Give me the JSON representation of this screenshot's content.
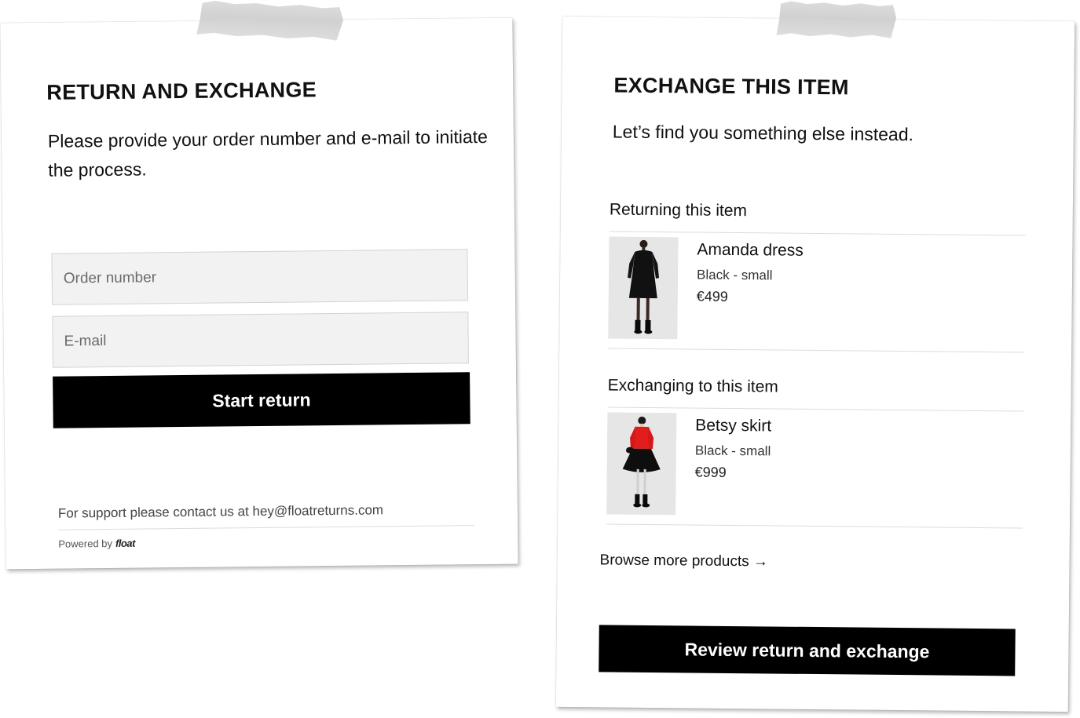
{
  "left_card": {
    "title": "RETURN AND EXCHANGE",
    "lead": "Please provide your order number and e-mail to initiate the process.",
    "order_placeholder": "Order number",
    "email_placeholder": "E-mail",
    "start_button": "Start return",
    "support_text": "For support please contact us at hey@floatreturns.com",
    "powered_by": "Powered by",
    "logo_text": "float"
  },
  "right_card": {
    "title": "EXCHANGE THIS ITEM",
    "lead": "Let’s find you something else instead.",
    "returning_label": "Returning this item",
    "returning_item": {
      "name": "Amanda dress",
      "variant": "Black - small",
      "price": "€499",
      "image": "model-black-dress"
    },
    "exchanging_label": "Exchanging to this item",
    "exchanging_item": {
      "name": "Betsy skirt",
      "variant": "Black - small",
      "price": "€999",
      "image": "model-red-top-black-skirt"
    },
    "browse_link": "Browse more products",
    "browse_arrow": "→",
    "review_button": "Review return and exchange"
  },
  "colors": {
    "button_bg": "#000000",
    "button_text": "#ffffff",
    "field_bg": "#f2f2f2",
    "tape": "#d3d3d3"
  }
}
